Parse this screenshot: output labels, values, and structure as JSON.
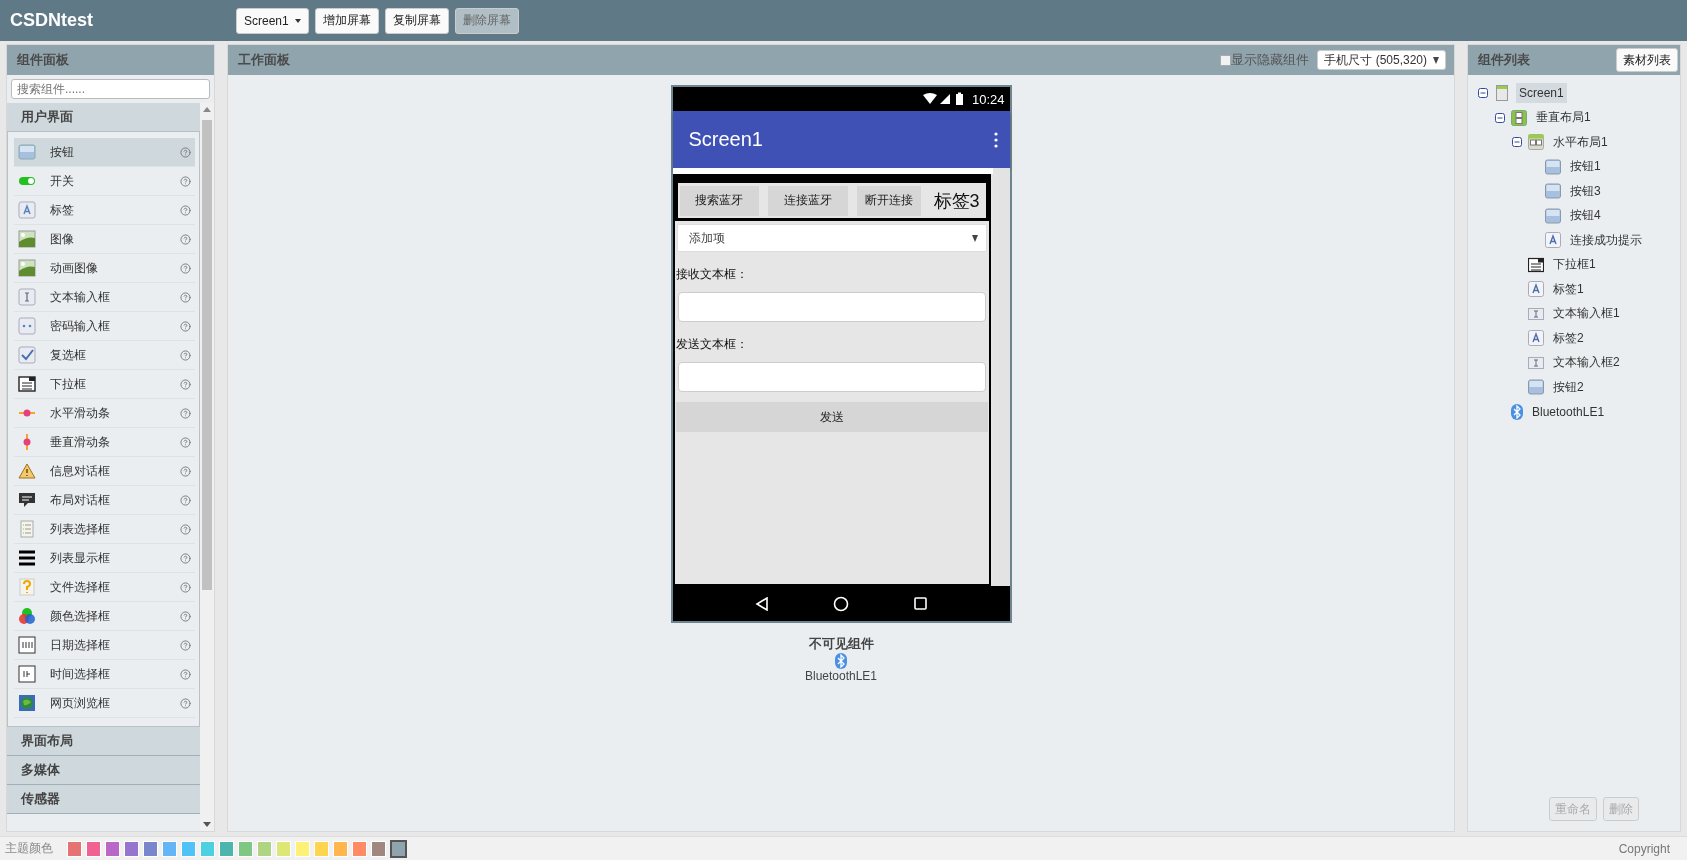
{
  "header": {
    "title": "CSDNtest",
    "screen_dropdown": "Screen1",
    "buttons": [
      {
        "label": "增加屏幕",
        "disabled": false
      },
      {
        "label": "复制屏幕",
        "disabled": false
      },
      {
        "label": "删除屏幕",
        "disabled": true
      }
    ]
  },
  "palette": {
    "title": "组件面板",
    "search_placeholder": "搜索组件......",
    "categories": [
      {
        "label": "用户界面",
        "expanded": true,
        "items": [
          {
            "label": "按钮",
            "selected": true
          },
          {
            "label": "开关",
            "selected": false
          },
          {
            "label": "标签",
            "selected": false
          },
          {
            "label": "图像",
            "selected": false
          },
          {
            "label": "动画图像",
            "selected": false
          },
          {
            "label": "文本输入框",
            "selected": false
          },
          {
            "label": "密码输入框",
            "selected": false
          },
          {
            "label": "复选框",
            "selected": false
          },
          {
            "label": "下拉框",
            "selected": false
          },
          {
            "label": "水平滑动条",
            "selected": false
          },
          {
            "label": "垂直滑动条",
            "selected": false
          },
          {
            "label": "信息对话框",
            "selected": false
          },
          {
            "label": "布局对话框",
            "selected": false
          },
          {
            "label": "列表选择框",
            "selected": false
          },
          {
            "label": "列表显示框",
            "selected": false
          },
          {
            "label": "文件选择框",
            "selected": false
          },
          {
            "label": "颜色选择框",
            "selected": false
          },
          {
            "label": "日期选择框",
            "selected": false
          },
          {
            "label": "时间选择框",
            "selected": false
          },
          {
            "label": "网页浏览框",
            "selected": false
          }
        ]
      },
      {
        "label": "界面布局",
        "expanded": false
      },
      {
        "label": "多媒体",
        "expanded": false
      },
      {
        "label": "传感器",
        "expanded": false
      }
    ]
  },
  "viewer": {
    "title": "工作面板",
    "show_hidden": {
      "label": "显示隐藏组件",
      "checked": false
    },
    "size_dropdown": "手机尺寸 (505,320)",
    "phone": {
      "time": "10:24",
      "app_title": "Screen1",
      "buttons": [
        "搜索蓝牙",
        "连接蓝牙",
        "断开连接"
      ],
      "status_label": "标签3",
      "spinner": "添加项",
      "receive_label": "接收文本框：",
      "send_label": "发送文本框：",
      "send_button": "发送"
    },
    "nonvisible": {
      "title": "不可见组件",
      "items": [
        "BluetoothLE1"
      ]
    }
  },
  "components": {
    "title": "组件列表",
    "assets_button": "素材列表",
    "tree": [
      {
        "label": "Screen1",
        "kind": "screen",
        "expanded": true,
        "selected": true,
        "children": [
          {
            "label": "垂直布局1",
            "kind": "vertical",
            "expanded": true,
            "selected": false,
            "children": [
              {
                "label": "水平布局1",
                "kind": "horizontal",
                "expanded": true,
                "selected": false,
                "children": [
                  {
                    "label": "按钮1",
                    "kind": "button",
                    "selected": false
                  },
                  {
                    "label": "按钮3",
                    "kind": "button",
                    "selected": false
                  },
                  {
                    "label": "按钮4",
                    "kind": "button",
                    "selected": false
                  },
                  {
                    "label": "连接成功提示",
                    "kind": "label",
                    "selected": false
                  }
                ]
              },
              {
                "label": "下拉框1",
                "kind": "spinner",
                "selected": false
              },
              {
                "label": "标签1",
                "kind": "label",
                "selected": false
              },
              {
                "label": "文本输入框1",
                "kind": "textbox",
                "selected": false
              },
              {
                "label": "标签2",
                "kind": "label",
                "selected": false
              },
              {
                "label": "文本输入框2",
                "kind": "textbox",
                "selected": false
              },
              {
                "label": "按钮2",
                "kind": "button",
                "selected": false
              }
            ]
          },
          {
            "label": "BluetoothLE1",
            "kind": "bluetooth",
            "selected": false
          }
        ]
      }
    ],
    "buttons": [
      {
        "label": "重命名",
        "disabled": true
      },
      {
        "label": "删除",
        "disabled": true
      }
    ]
  },
  "theme": {
    "label": "主题颜色",
    "swatches": [
      {
        "color": "#e57373",
        "selected": false
      },
      {
        "color": "#f06292",
        "selected": false
      },
      {
        "color": "#ba68c8",
        "selected": false
      },
      {
        "color": "#9575cd",
        "selected": false
      },
      {
        "color": "#7986cb",
        "selected": false
      },
      {
        "color": "#64b5f6",
        "selected": false
      },
      {
        "color": "#4fc3f7",
        "selected": false
      },
      {
        "color": "#4dd0e1",
        "selected": false
      },
      {
        "color": "#4db6ac",
        "selected": false
      },
      {
        "color": "#81c784",
        "selected": false
      },
      {
        "color": "#aed581",
        "selected": false
      },
      {
        "color": "#dce775",
        "selected": false
      },
      {
        "color": "#fff176",
        "selected": false
      },
      {
        "color": "#ffd54f",
        "selected": false
      },
      {
        "color": "#ffb74d",
        "selected": false
      },
      {
        "color": "#ff8a65",
        "selected": false
      },
      {
        "color": "#a1887f",
        "selected": false
      },
      {
        "color": "#90a4ae",
        "selected": true
      }
    ]
  },
  "copyright": "Copyright"
}
